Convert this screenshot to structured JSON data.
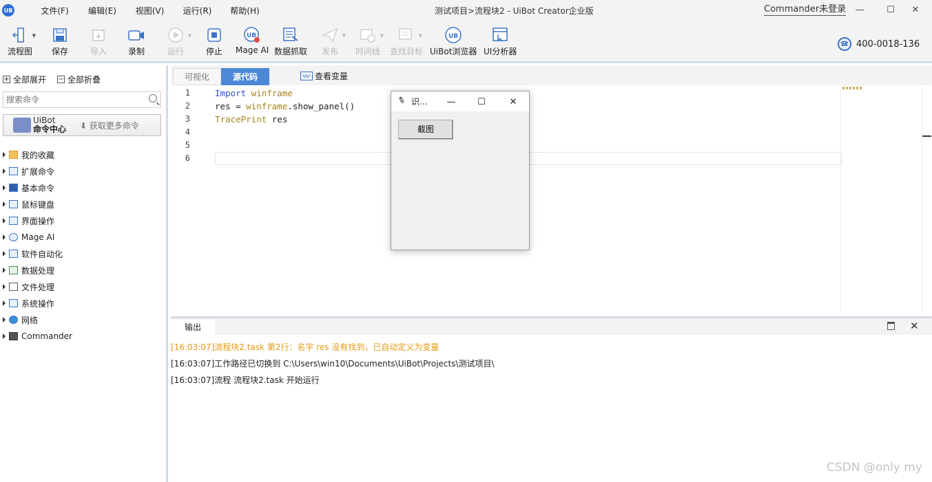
{
  "menu": [
    "文件(F)",
    "编辑(E)",
    "视图(V)",
    "运行(R)",
    "帮助(H)"
  ],
  "window_title": "测试项目>流程块2 - UiBot Creator企业版",
  "login_text": "Commander未登录",
  "toolbar": {
    "flowchart": "流程图",
    "save": "保存",
    "import": "导入",
    "record": "录制",
    "run": "运行",
    "stop": "停止",
    "mage_ai": "Mage AI",
    "data_capture": "数据抓取",
    "publish": "发布",
    "timeline": "时间线",
    "find_target": "查找目标",
    "uibot_browser": "UiBot浏览器",
    "ui_analyzer": "UI分析器"
  },
  "phone": "400-0018-136",
  "sidebar": {
    "expand_all": "全部展开",
    "collapse_all": "全部折叠",
    "search_placeholder": "搜索命令",
    "cmd_center_line1": "UiBot",
    "cmd_center_line2": "命令中心",
    "get_more": "获取更多命令",
    "items": [
      "我的收藏",
      "扩展命令",
      "基本命令",
      "鼠标键盘",
      "界面操作",
      "Mage AI",
      "软件自动化",
      "数据处理",
      "文件处理",
      "系统操作",
      "网络",
      "Commander"
    ]
  },
  "editor": {
    "tabs": [
      "可视化",
      "源代码"
    ],
    "view_variables": "查看变量",
    "lines": [
      {
        "n": "1",
        "k": "Import",
        "r": " winframe"
      },
      {
        "n": "2",
        "a": "res = ",
        "b": "winframe",
        "c": ".show_panel()"
      },
      {
        "n": "3",
        "k": "TracePrint",
        "r": " res"
      },
      {
        "n": "4"
      },
      {
        "n": "5"
      },
      {
        "n": "6"
      }
    ]
  },
  "output": {
    "tab": "输出",
    "logs": [
      "[16:03:07]流程块2.task 第2行：名字 res 没有找到，已自动定义为变量",
      "[16:03:07]工作路径已切换到 C:\\Users\\win10\\Documents\\UiBot\\Projects\\测试项目\\",
      "[16:03:07]流程 流程块2.task 开始运行"
    ]
  },
  "float_window": {
    "title": "识...",
    "button": "截图"
  },
  "watermark": "CSDN @only my",
  "colors": {
    "accent": "#4c87d8",
    "warning": "#e59a12",
    "keyword": "#2a4fcf",
    "function": "#a7821a"
  }
}
